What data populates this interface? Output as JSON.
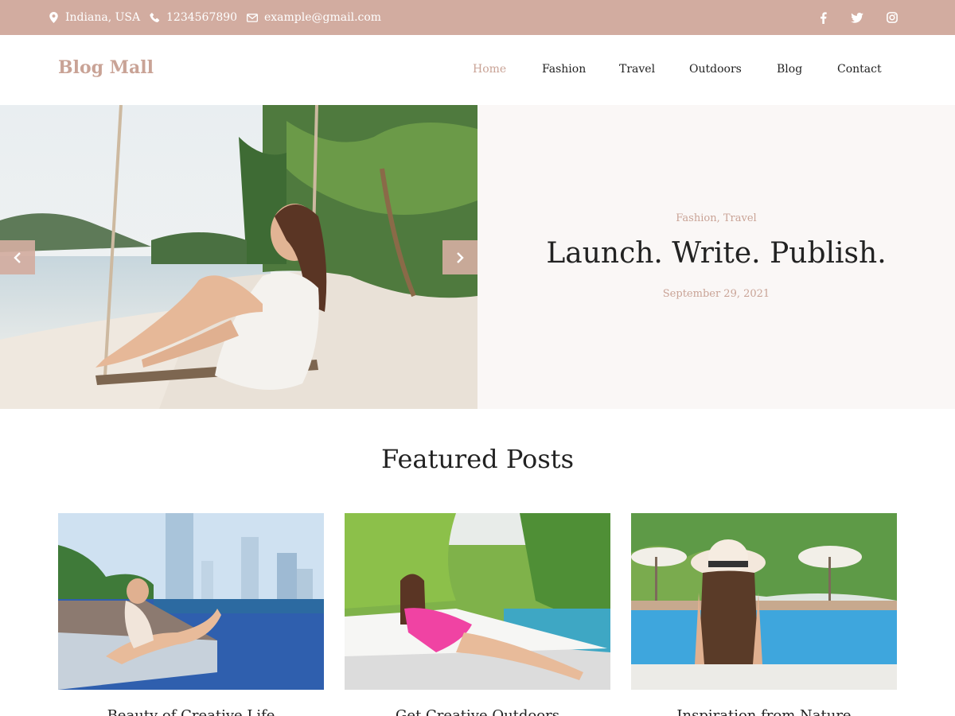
{
  "topbar": {
    "location": "Indiana, USA",
    "phone": "1234567890",
    "email": "example@gmail.com",
    "social": [
      "facebook-icon",
      "twitter-icon",
      "instagram-icon"
    ]
  },
  "header": {
    "logo": "Blog Mall",
    "nav": [
      "Home",
      "Fashion",
      "Travel",
      "Outdoors",
      "Blog",
      "Contact"
    ],
    "active": "Home"
  },
  "hero": {
    "categories_1": "Fashion",
    "categories_sep": ", ",
    "categories_2": "Travel",
    "title": "Launch. Write. Publish.",
    "date": "September 29, 2021"
  },
  "featured": {
    "heading": "Featured Posts",
    "posts": [
      {
        "title": "Beauty of Creative Life"
      },
      {
        "title": "Get Creative Outdoors"
      },
      {
        "title": "Inspiration from Nature"
      }
    ]
  },
  "colors": {
    "accent": "#d2aca0",
    "accent_text": "#c9a396",
    "hero_bg": "#faf7f6"
  }
}
